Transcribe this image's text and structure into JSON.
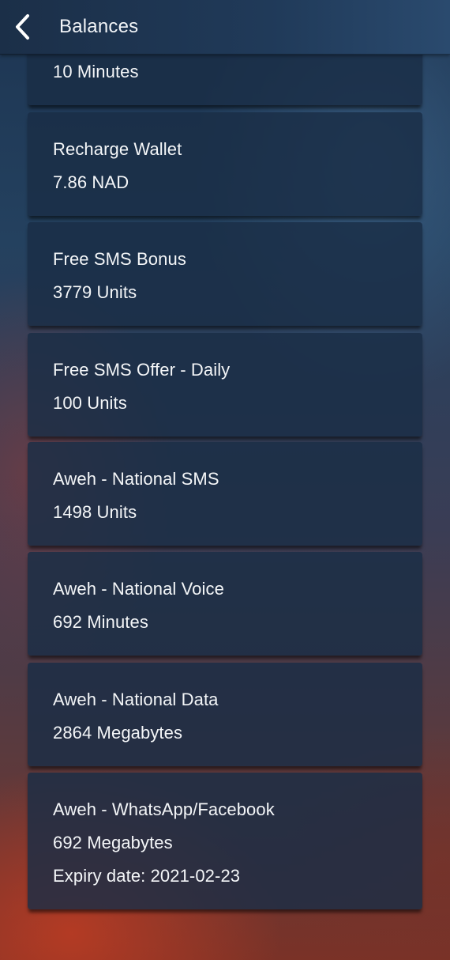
{
  "header": {
    "title": "Balances",
    "back_icon": "chevron-left-icon"
  },
  "balances": [
    {
      "name": "",
      "value": "10 Minutes"
    },
    {
      "name": "Recharge Wallet",
      "value": "7.86 NAD"
    },
    {
      "name": "Free SMS Bonus",
      "value": "3779 Units"
    },
    {
      "name": "Free SMS Offer - Daily",
      "value": "100 Units"
    },
    {
      "name": "Aweh - National SMS",
      "value": "1498 Units"
    },
    {
      "name": "Aweh - National Voice",
      "value": "692 Minutes"
    },
    {
      "name": "Aweh - National Data",
      "value": "2864 Megabytes"
    },
    {
      "name": "Aweh - WhatsApp/Facebook",
      "value": "692 Megabytes",
      "expiry": "Expiry date: 2021-02-23"
    }
  ]
}
